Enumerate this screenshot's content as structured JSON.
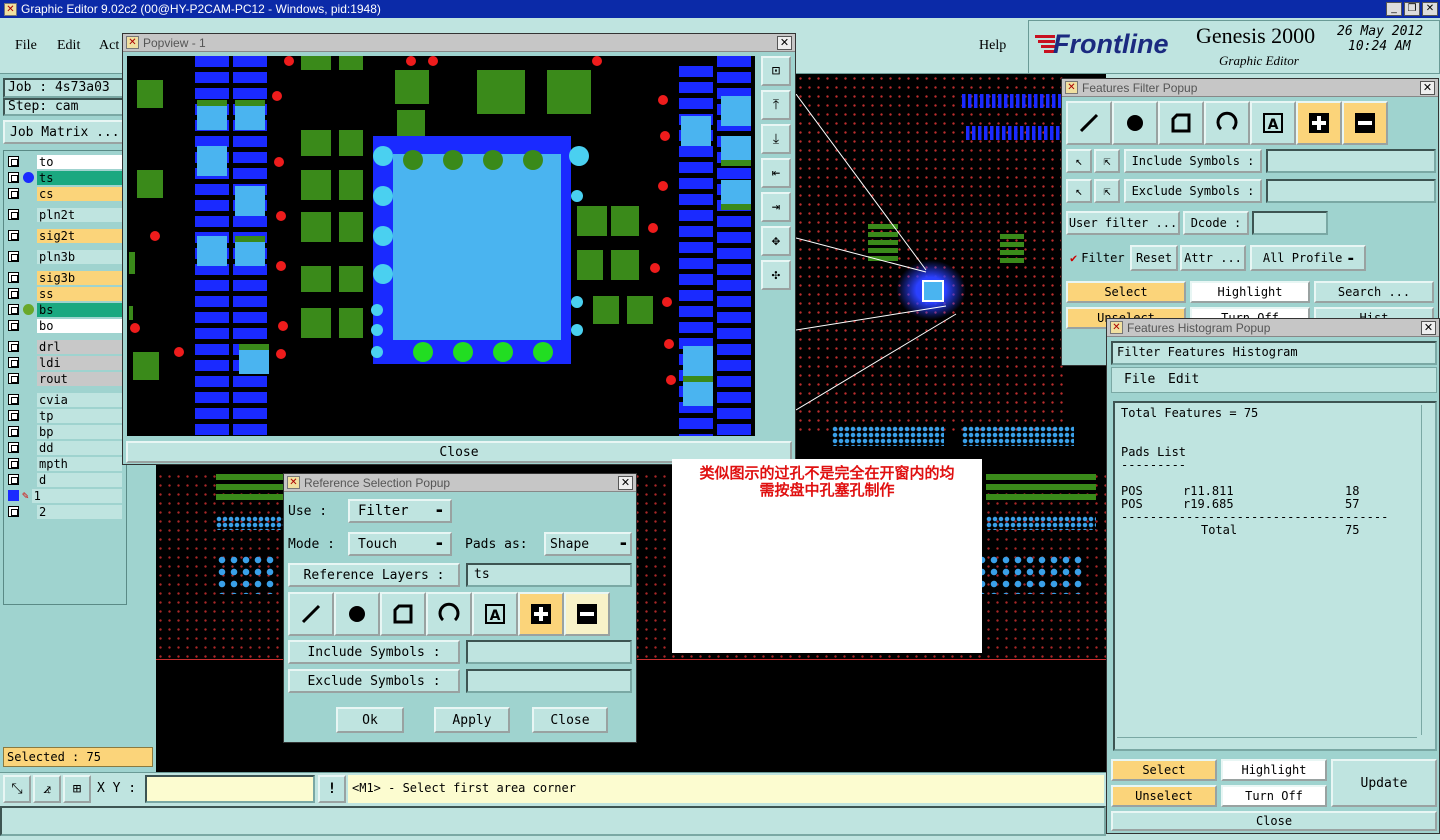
{
  "app_title": "Graphic Editor 9.02c2 (00@HY-P2CAM-PC12 - Windows, pid:1948)",
  "menu": [
    "File",
    "Edit",
    "Act",
    "Help"
  ],
  "brand": {
    "logo": "Frontline",
    "product": "Genesis 2000",
    "subtitle": "Graphic Editor",
    "date": "26 May 2012",
    "time": "10:24 AM"
  },
  "job": {
    "job_label": "Job : 4s73a03",
    "step_label": "Step: cam",
    "matrix_btn": "Job Matrix ..."
  },
  "layers": [
    {
      "name": "to",
      "color": "#ffffff"
    },
    {
      "name": "ts",
      "color": "#1aa880"
    },
    {
      "name": "cs",
      "color": "#fbd47a"
    },
    {
      "name": "pln2t",
      "color": "#bfe4e0"
    },
    {
      "name": "sig2t",
      "color": "#fbd47a"
    },
    {
      "name": "pln3b",
      "color": "#bfe4e0"
    },
    {
      "name": "sig3b",
      "color": "#fbd47a"
    },
    {
      "name": "ss",
      "color": "#fbd47a"
    },
    {
      "name": "bs",
      "color": "#1aa880"
    },
    {
      "name": "bo",
      "color": "#ffffff"
    },
    {
      "name": "drl",
      "color": "#c8c8c8"
    },
    {
      "name": "ldi",
      "color": "#c8c8c8"
    },
    {
      "name": "rout",
      "color": "#c8c8c8"
    },
    {
      "name": "cvia",
      "color": "#bfe4e0"
    },
    {
      "name": "tp",
      "color": "#bfe4e0"
    },
    {
      "name": "bp",
      "color": "#bfe4e0"
    },
    {
      "name": "dd",
      "color": "#bfe4e0"
    },
    {
      "name": "mpth",
      "color": "#bfe4e0"
    },
    {
      "name": "d",
      "color": "#bfe4e0"
    },
    {
      "name": "1",
      "color": "#bfe4e0"
    },
    {
      "name": "2",
      "color": "#bfe4e0"
    }
  ],
  "status": {
    "selected": "Selected : 75",
    "xy_label": "X Y :",
    "xy_value": "",
    "prompt": "<M1> - Select first area corner"
  },
  "popview": {
    "title": "Popview - 1",
    "close": "Close"
  },
  "annotation": {
    "line1": "类似图示的过孔不是完全在开窗内的均",
    "line2": "需按盘中孔塞孔制作"
  },
  "ref_popup": {
    "title": "Reference Selection Popup",
    "use_label": "Use  :",
    "use_value": "Filter",
    "mode_label": "Mode :",
    "mode_value": "Touch",
    "pads_label": "Pads as:",
    "pads_value": "Shape",
    "ref_layers_label": "Reference Layers :",
    "ref_layers_value": "ts",
    "include_label": "Include Symbols :",
    "exclude_label": "Exclude Symbols :",
    "ok": "Ok",
    "apply": "Apply",
    "close": "Close"
  },
  "filter_popup": {
    "title": "Features Filter Popup",
    "include_label": "Include Symbols :",
    "exclude_label": "Exclude Symbols :",
    "user_filter": "User filter ...",
    "dcode_label": "Dcode :",
    "filter_label": "Filter",
    "reset": "Reset",
    "attr": "Attr ...",
    "profile": "All Profile",
    "select": "Select",
    "highlight": "Highlight",
    "search": "Search ...",
    "unselect_partial": "Unselect",
    "turnoff_partial": "Turn Off",
    "hist_partial": "Hist"
  },
  "hist_popup": {
    "title": "Features Histogram Popup",
    "header": "Filter Features Histogram",
    "menu_file": "File",
    "menu_edit": "Edit",
    "total_line": "Total Features = 75",
    "pads_list": "Pads List",
    "pads_underline": "---------",
    "rows": [
      {
        "type": "POS",
        "symbol": "r11.811",
        "count": "18"
      },
      {
        "type": "POS",
        "symbol": "r19.685",
        "count": "57"
      }
    ],
    "separator": "--------------------------------------------",
    "total_label": "Total",
    "total_count": "75",
    "select": "Select",
    "highlight": "Highlight",
    "update": "Update",
    "unselect": "Unselect",
    "turnoff": "Turn Off",
    "close": "Close"
  }
}
